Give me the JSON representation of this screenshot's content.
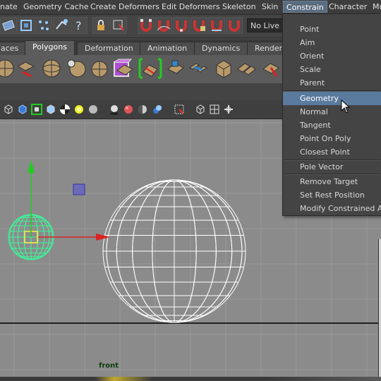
{
  "menubar": {
    "items": [
      "nate",
      "Geometry Cache",
      "Create Deformers",
      "Edit Deformers",
      "Skeleton",
      "Skin",
      "Constrain",
      "Character",
      "Mu"
    ],
    "active_item": "Constrain"
  },
  "toolbar": {
    "live_surface_field": "No Live Su"
  },
  "shelf_tabs": {
    "items": [
      "aces",
      "Polygons",
      "Deformation",
      "Animation",
      "Dynamics",
      "Renderi"
    ],
    "active": "Polygons"
  },
  "viewport": {
    "camera_label": "front",
    "background_color": "#8b8b8b",
    "grid_color": "#9a9a9a"
  },
  "constrain_menu": {
    "items": [
      {
        "label": "Point"
      },
      {
        "label": "Aim"
      },
      {
        "label": "Orient"
      },
      {
        "label": "Scale"
      },
      {
        "label": "Parent"
      },
      {
        "label": "Geometry",
        "highlighted": true
      },
      {
        "label": "Normal"
      },
      {
        "label": "Tangent"
      },
      {
        "label": "Point On Poly"
      },
      {
        "label": "Closest Point"
      },
      {
        "label": "Pole Vector"
      },
      {
        "label": "Remove Target"
      },
      {
        "label": "Set Rest Position"
      },
      {
        "label": "Modify Constrained Axis"
      }
    ],
    "highlight_color": "#5a7a9e"
  }
}
